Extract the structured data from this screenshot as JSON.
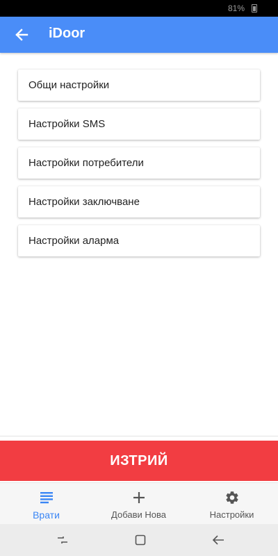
{
  "status_bar": {
    "battery": "81%"
  },
  "app_bar": {
    "title": "iDoor"
  },
  "menu": {
    "items": [
      {
        "label": "Общи настройки"
      },
      {
        "label": "Настройки SMS"
      },
      {
        "label": "Настройки потребители"
      },
      {
        "label": "Настройки заключване"
      },
      {
        "label": "Настройки аларма"
      }
    ]
  },
  "delete_button": {
    "label": "ИЗТРИЙ"
  },
  "bottom_nav": {
    "items": [
      {
        "label": "Врати",
        "icon": "list-icon",
        "active": true
      },
      {
        "label": "Добави Нова",
        "icon": "plus-icon",
        "active": false
      },
      {
        "label": "Настройки",
        "icon": "gear-icon",
        "active": false
      }
    ]
  },
  "colors": {
    "app_bar": "#4a8df8",
    "delete": "#f23d42",
    "nav_active": "#3a86f5"
  }
}
